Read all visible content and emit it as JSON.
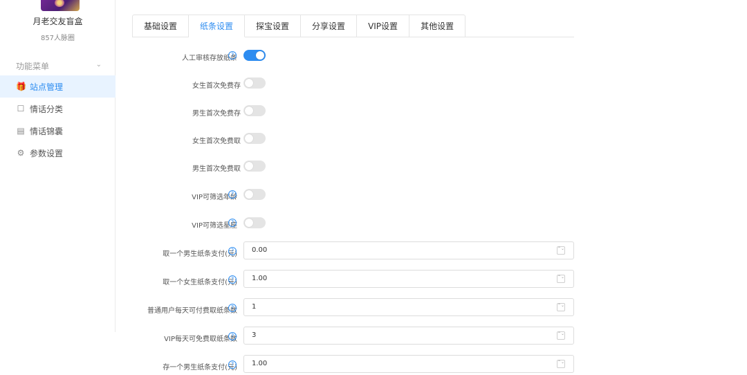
{
  "sidebar": {
    "site_name": "月老交友盲盒",
    "site_sub": "857人脉圈",
    "menu_header": "功能菜单",
    "items": [
      {
        "label": "站点管理",
        "icon": "gift-icon",
        "glyph": "🎁",
        "active": true
      },
      {
        "label": "情话分类",
        "icon": "bookmark-icon",
        "glyph": "☐",
        "active": false
      },
      {
        "label": "情话锦囊",
        "icon": "document-icon",
        "glyph": "▤",
        "active": false
      },
      {
        "label": "参数设置",
        "icon": "gear-icon",
        "glyph": "⚙",
        "active": false
      }
    ]
  },
  "tabs": [
    {
      "label": "基础设置",
      "active": false
    },
    {
      "label": "纸条设置",
      "active": true
    },
    {
      "label": "探宝设置",
      "active": false
    },
    {
      "label": "分享设置",
      "active": false
    },
    {
      "label": "VIP设置",
      "active": false
    },
    {
      "label": "其他设置",
      "active": false
    }
  ],
  "form": {
    "toggles": [
      {
        "label": "人工审核存放纸条",
        "help": true,
        "on": true
      },
      {
        "label": "女生首次免费存",
        "help": false,
        "on": false
      },
      {
        "label": "男生首次免费存",
        "help": false,
        "on": false
      },
      {
        "label": "女生首次免费取",
        "help": false,
        "on": false
      },
      {
        "label": "男生首次免费取",
        "help": false,
        "on": false
      },
      {
        "label": "VIP可筛选年龄",
        "help": true,
        "on": false
      },
      {
        "label": "VIP可筛选星座",
        "help": true,
        "on": false
      }
    ],
    "inputs": [
      {
        "label": "取一个男生纸条支付(元)",
        "value": "0.00"
      },
      {
        "label": "取一个女生纸条支付(元)",
        "value": "1.00"
      },
      {
        "label": "普通用户每天可付费取纸条数",
        "value": "1"
      },
      {
        "label": "VIP每天可免费取纸条数",
        "value": "3"
      },
      {
        "label": "存一个男生纸条支付(元)",
        "value": "1.00"
      }
    ],
    "help_glyph": "?",
    "stepper_glyph": "⌃⌄"
  },
  "colors": {
    "accent": "#2d8cf0",
    "active_bg": "#e8f3ff",
    "toggle_off": "#e4e4e4"
  }
}
